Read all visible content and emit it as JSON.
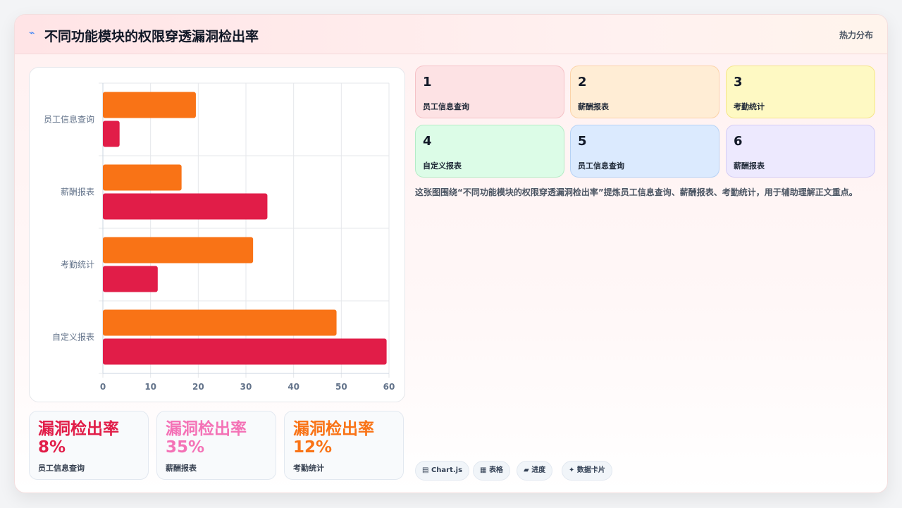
{
  "header": {
    "icon": "pulse-icon",
    "title": "不同功能模块的权限穿透漏洞检出率",
    "tag": "热力分布"
  },
  "chart_data": {
    "type": "bar",
    "orientation": "horizontal",
    "categories": [
      "员工信息查询",
      "薪酬报表",
      "考勤统计",
      "自定义报表"
    ],
    "series": [
      {
        "color": "#f97316",
        "values": [
          19.5,
          16.5,
          31.5,
          49
        ]
      },
      {
        "color": "#e11d48",
        "values": [
          3.5,
          34.5,
          11.5,
          59.5
        ]
      }
    ],
    "xlim": [
      0,
      60
    ],
    "xticks": [
      "0",
      "10",
      "20",
      "30",
      "40",
      "50",
      "60"
    ],
    "grid": true,
    "legend": "none"
  },
  "kpis": [
    {
      "value": "漏洞检出率 8%",
      "label": "员工信息查询",
      "color": "#e11d48"
    },
    {
      "value": "漏洞检出率 35%",
      "label": "薪酬报表",
      "color": "#f472b6"
    },
    {
      "value": "漏洞检出率 12%",
      "label": "考勤统计",
      "color": "#f97316"
    }
  ],
  "tiles": [
    {
      "num": "1",
      "label": "员工信息查询",
      "bg": "#fde2e4",
      "border": "#f5c2c7"
    },
    {
      "num": "2",
      "label": "薪酬报表",
      "bg": "#ffedd5",
      "border": "#fbd3a8"
    },
    {
      "num": "3",
      "label": "考勤统计",
      "bg": "#fef9c3",
      "border": "#f5e58a"
    },
    {
      "num": "4",
      "label": "自定义报表",
      "bg": "#dcfce7",
      "border": "#b4ecc6"
    },
    {
      "num": "5",
      "label": "员工信息查询",
      "bg": "#dbeafe",
      "border": "#b6d2f5"
    },
    {
      "num": "6",
      "label": "薪酬报表",
      "bg": "#ede9fe",
      "border": "#d5cdf5"
    }
  ],
  "description": "这张图围绕“不同功能模块的权限穿透漏洞检出率”提炼员工信息查询、薪酬报表、考勤统计，用于辅助理解正文重点。",
  "pills": [
    {
      "icon": "chart-icon",
      "glyph": "▤",
      "label": "Chart.js"
    },
    {
      "icon": "table-icon",
      "glyph": "▦",
      "label": "表格"
    },
    {
      "icon": "progress-icon",
      "glyph": "▰",
      "label": "进度"
    },
    {
      "icon": "sparkle-icon",
      "glyph": "✦",
      "label": "数据卡片"
    }
  ]
}
